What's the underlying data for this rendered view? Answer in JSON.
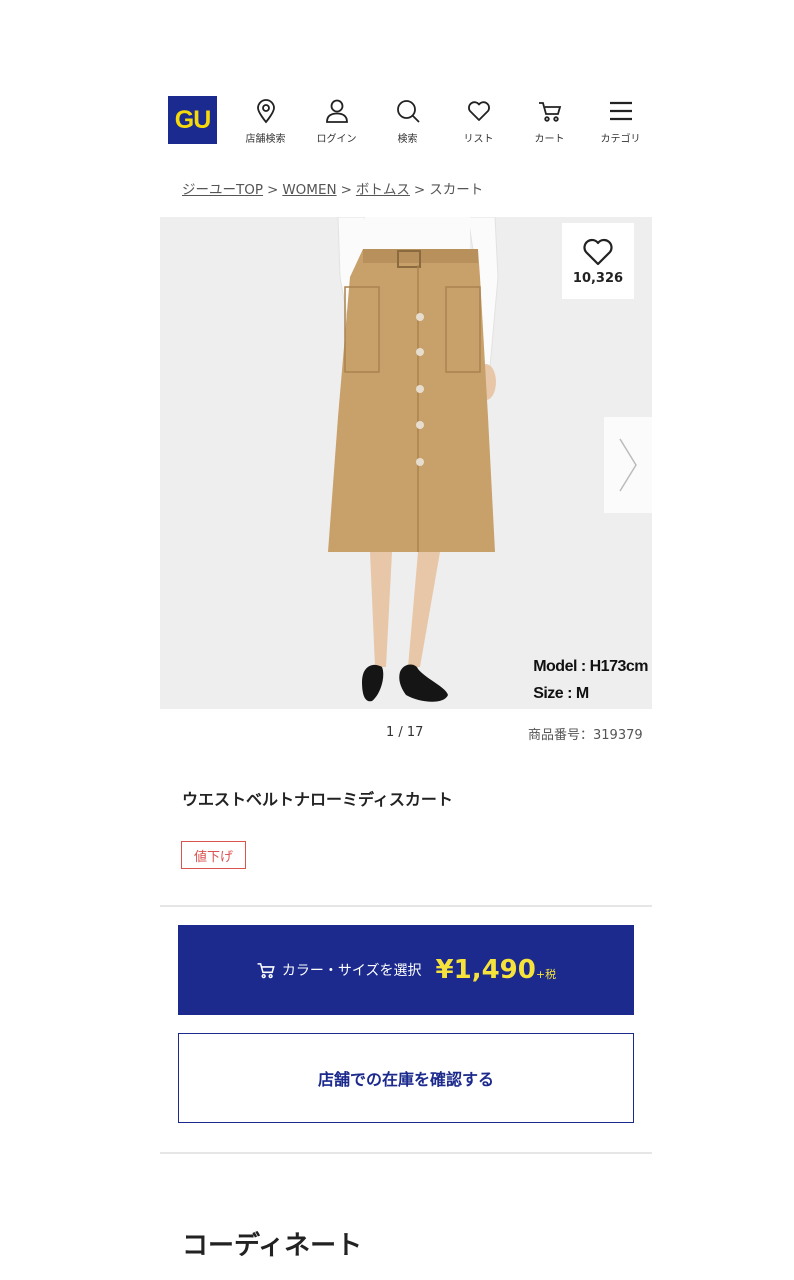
{
  "header": {
    "logo": "GU",
    "nav": [
      {
        "label": "店舗検索",
        "icon": "location-pin-icon"
      },
      {
        "label": "ログイン",
        "icon": "user-icon"
      },
      {
        "label": "検索",
        "icon": "search-icon"
      },
      {
        "label": "リスト",
        "icon": "heart-icon"
      },
      {
        "label": "カート",
        "icon": "cart-icon"
      },
      {
        "label": "カテゴリ",
        "icon": "menu-icon"
      }
    ]
  },
  "breadcrumb": {
    "items": [
      "ジーユーTOP",
      "WOMEN",
      "ボトムス"
    ],
    "separator": ">",
    "current": "スカート"
  },
  "gallery": {
    "favorite_count": "10,326",
    "model_height": "Model : H173cm",
    "model_size": "Size : M",
    "counter": "1 / 17"
  },
  "product": {
    "number": "商品番号：319379",
    "title": "ウエストベルトナローミディスカート",
    "badge": "値下げ"
  },
  "actions": {
    "buy_label": "カラー・サイズを選択",
    "price": "¥1,490",
    "tax": "+税",
    "stock_label": "店舗での在庫を確認する"
  },
  "section": {
    "title": "コーディネート"
  },
  "colors": {
    "brand_navy": "#1b2a8c",
    "price_yellow": "#f5e23a",
    "badge_red": "#d9534f",
    "skirt_beige": "#c8a06a"
  }
}
